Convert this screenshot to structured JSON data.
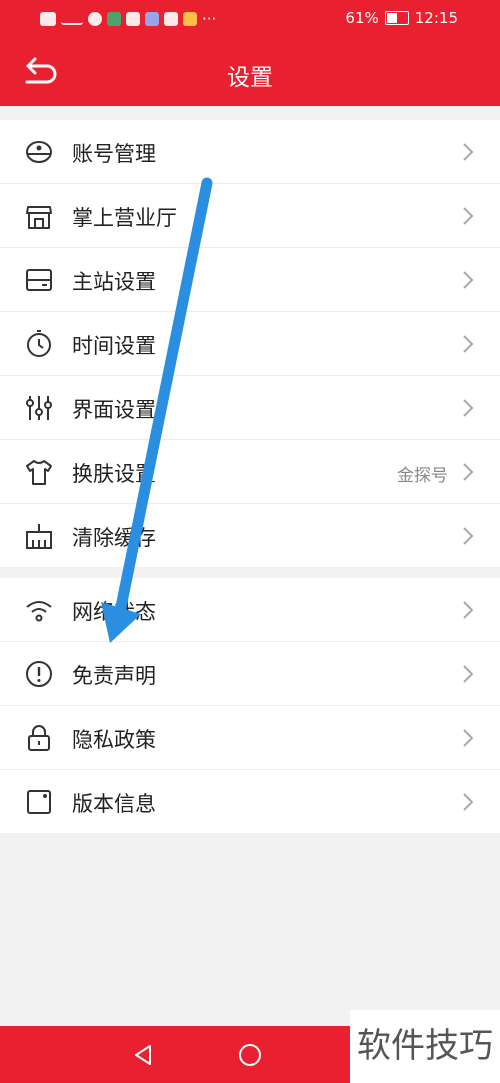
{
  "status_bar": {
    "battery_percent": "61%",
    "battery_level": 0.61,
    "time": "12:15"
  },
  "header": {
    "title": "设置"
  },
  "groups": [
    {
      "items": [
        {
          "label": "账号管理",
          "icon": "account-icon"
        },
        {
          "label": "掌上营业厅",
          "icon": "store-icon"
        },
        {
          "label": "主站设置",
          "icon": "server-icon"
        },
        {
          "label": "时间设置",
          "icon": "clock-icon"
        },
        {
          "label": "界面设置",
          "icon": "sliders-icon"
        },
        {
          "label": "换肤设置",
          "icon": "shirt-icon",
          "value": "金探号"
        },
        {
          "label": "清除缓存",
          "icon": "clear-cache-icon"
        }
      ]
    },
    {
      "items": [
        {
          "label": "网络状态",
          "icon": "wifi-icon"
        },
        {
          "label": "免责声明",
          "icon": "alert-icon"
        },
        {
          "label": "隐私政策",
          "icon": "lock-icon"
        },
        {
          "label": "版本信息",
          "icon": "version-icon"
        }
      ]
    }
  ],
  "watermark": "软件技巧",
  "colors": {
    "brand": "#e8202f",
    "arrow": "#2a8fe0"
  }
}
